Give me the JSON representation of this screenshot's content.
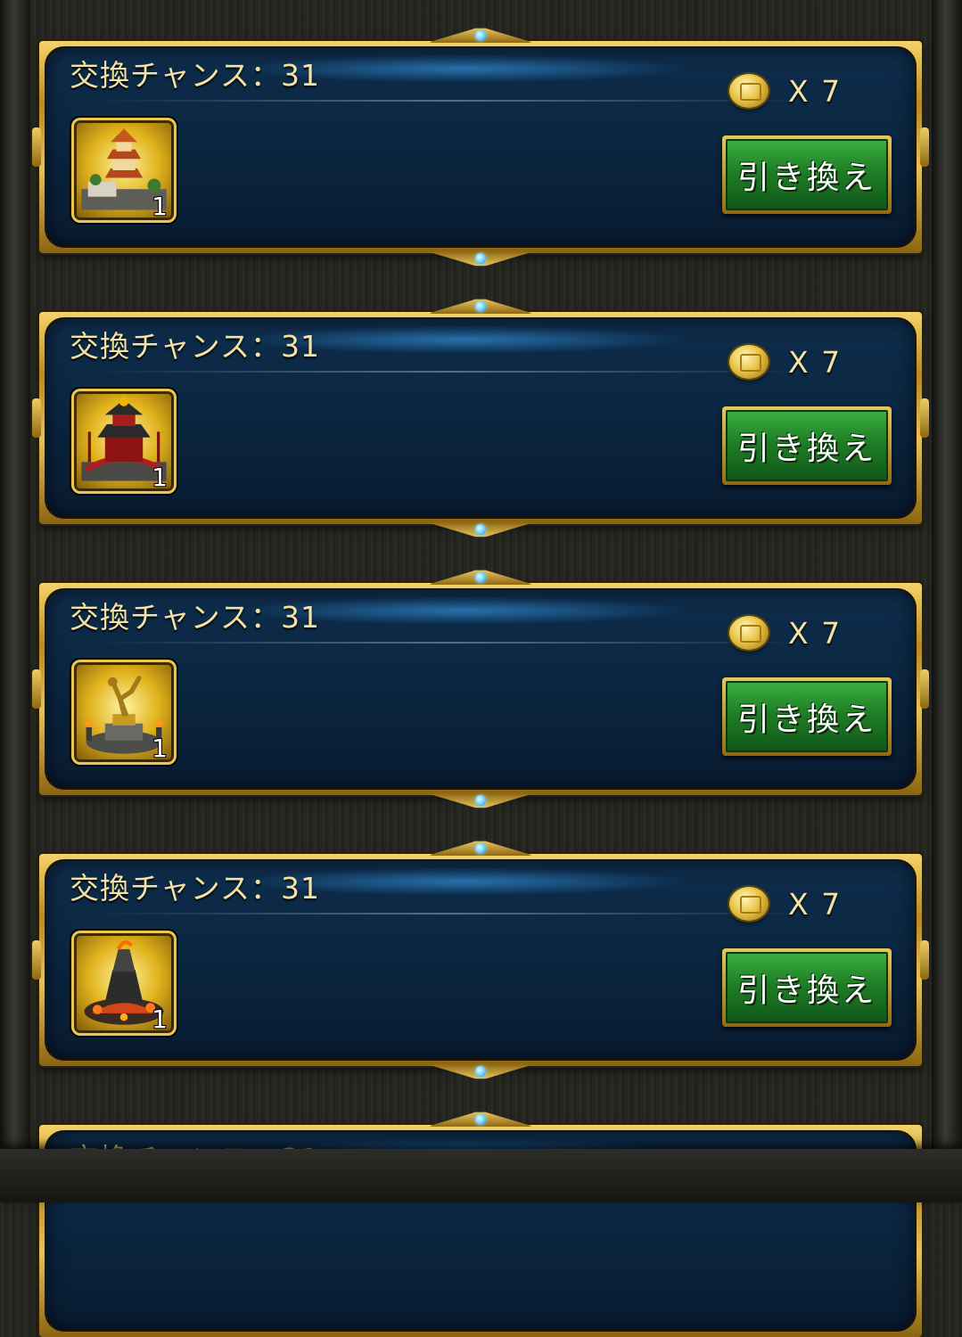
{
  "cards": [
    {
      "title": "交換チャンス：31",
      "item_name": "pagoda-building-icon",
      "quantity": "1",
      "cost_text": "X 7",
      "button_label": "引き換え"
    },
    {
      "title": "交換チャンス：31",
      "item_name": "red-shrine-building-icon",
      "quantity": "1",
      "cost_text": "X 7",
      "button_label": "引き換え"
    },
    {
      "title": "交換チャンス：31",
      "item_name": "discus-thrower-statue-icon",
      "quantity": "1",
      "cost_text": "X 7",
      "button_label": "引き換え"
    },
    {
      "title": "交換チャンス：31",
      "item_name": "volcano-forge-building-icon",
      "quantity": "1",
      "cost_text": "X 7",
      "button_label": "引き換え"
    }
  ],
  "partial_card": {
    "title": "交換チャンス：31"
  },
  "colors": {
    "panel": "#0b2844",
    "gold": "#e8c155",
    "button_green": "#1f7f25",
    "text_gold": "#f2e2a4"
  }
}
